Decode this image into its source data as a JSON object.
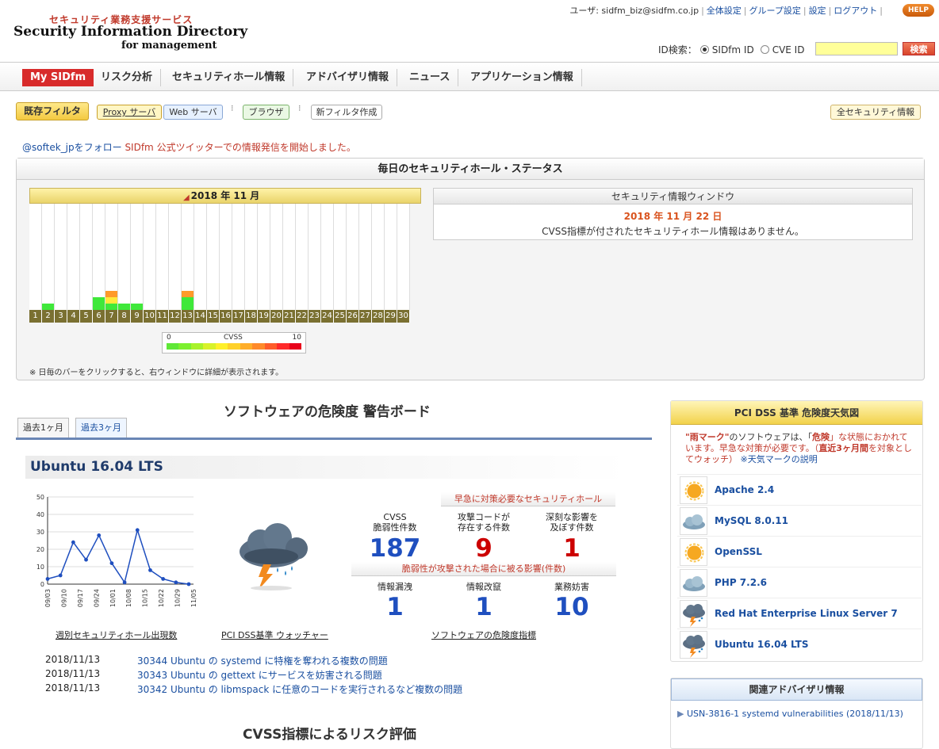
{
  "header": {
    "logo_sub": "セキュリティ業務支援サービス",
    "logo_main": "Security Information Directory",
    "logo_main2": "for management",
    "user_label": "ユーザ: sidfm_biz@sidfm.co.jp",
    "links": [
      "全体設定",
      "グループ設定",
      "設定",
      "ログアウト"
    ],
    "help": "HELP",
    "id_search_label": "ID検索：",
    "radio_sidfm": "SIDfm ID",
    "radio_cve": "CVE ID",
    "search_button": "検索"
  },
  "nav": [
    "My SIDfm",
    "リスク分析",
    "セキュリティホール情報",
    "アドバイザリ情報",
    "ニュース",
    "アプリケーション情報"
  ],
  "filters": {
    "existing": "既存フィルタ",
    "proxy": "Proxy サーバ",
    "web": "Web サーバ",
    "browser": "ブラウザ",
    "new_filter": "新フィルタ作成",
    "all_security": "全セキュリティ情報"
  },
  "notice": {
    "part1": "@softek_jpをフォロー",
    "part2": "SIDfm 公式ツイッターでの情報発信を開始しました。"
  },
  "status": {
    "title": "毎日のセキュリティホール・ステータス",
    "calendar_title": "2018 年 11 月",
    "legend_min": "0",
    "legend_label": "CVSS",
    "legend_max": "10",
    "note": "※ 日毎のバーをクリックすると、右ウィンドウに詳細が表示されます。",
    "window_title": "セキュリティ情報ウィンドウ",
    "window_date": "2018 年 11 月 22 日",
    "window_msg": "CVSS指標が付されたセキュリティホール情報はありません。",
    "days": [
      "1",
      "2",
      "3",
      "4",
      "5",
      "6",
      "7",
      "8",
      "9",
      "10",
      "11",
      "12",
      "13",
      "14",
      "15",
      "16",
      "17",
      "18",
      "19",
      "20",
      "21",
      "22",
      "23",
      "24",
      "25",
      "26",
      "27",
      "28",
      "29",
      "30"
    ]
  },
  "board": {
    "title": "ソフトウェアの危険度 警告ボード",
    "tab_1m": "過去1ヶ月",
    "tab_3m": "過去3ヶ月",
    "software": "Ubuntu 16.04 LTS",
    "caption_chart": "週別セキュリティホール出現数",
    "caption_weather": "PCI DSS基準 ウォッチャー",
    "caption_metrics": "ソフトウェアの危険度指標",
    "urgent_head": "早急に対策必要なセキュリティホール",
    "impact_head": "脆弱性が攻撃された場合に被る影響(件数)",
    "metrics": {
      "cvss_label": "CVSS\n脆弱性件数",
      "cvss_value": "187",
      "exploit_label": "攻撃コードが\n存在する件数",
      "exploit_value": "9",
      "severe_label": "深刻な影響を\n及ぼす件数",
      "severe_value": "1",
      "leak_label": "情報漏洩",
      "leak_value": "1",
      "tamper_label": "情報改竄",
      "tamper_value": "1",
      "dos_label": "業務妨害",
      "dos_value": "10"
    },
    "news": [
      {
        "date": "2018/11/13",
        "text": "30344 Ubuntu の systemd に特権を奪われる複数の問題"
      },
      {
        "date": "2018/11/13",
        "text": "30343 Ubuntu の gettext にサービスを妨害される問題"
      },
      {
        "date": "2018/11/13",
        "text": "30342 Ubuntu の libmspack に任意のコードを実行されるなど複数の問題"
      }
    ],
    "cvss_title": "CVSS指標によるリスク評価"
  },
  "chart_data": {
    "type": "line",
    "title": "",
    "x": [
      "09/03",
      "09/10",
      "09/17",
      "09/24",
      "10/01",
      "10/08",
      "10/15",
      "10/22",
      "10/29",
      "11/05"
    ],
    "series_x_labels": [
      "09/03",
      "09/10",
      "09/17",
      "09/24",
      "10/01",
      "10/08",
      "10/15",
      "10/22",
      "10/29",
      "11/05"
    ],
    "values": [
      3,
      5,
      24,
      14,
      28,
      12,
      1,
      31,
      8,
      3,
      1,
      0
    ],
    "ylim": [
      0,
      50
    ],
    "yticks": [
      "50",
      "40",
      "30",
      "20",
      "10",
      "0"
    ],
    "color": "#1f4fbf"
  },
  "pci": {
    "title": "PCI DSS 基準 危険度天気図",
    "desc_a": "\"雨マーク\"",
    "desc_b": "のソフトウェアは、「",
    "desc_c": "危険",
    "desc_d": "」な状態におかれています。早急な対策が必要です。（",
    "desc_e": "直近3ヶ月間",
    "desc_f": "を対象としてウォッチ）",
    "desc_link": "※天気マークの説明",
    "items": [
      {
        "name": "Apache 2.4",
        "icon": "sunny-icon"
      },
      {
        "name": "MySQL 8.0.11",
        "icon": "cloudy-icon"
      },
      {
        "name": "OpenSSL",
        "icon": "sunny-icon"
      },
      {
        "name": "PHP 7.2.6",
        "icon": "cloudy-icon"
      },
      {
        "name": "Red Hat Enterprise Linux Server 7",
        "icon": "storm-icon"
      },
      {
        "name": "Ubuntu 16.04 LTS",
        "icon": "storm-icon"
      }
    ]
  },
  "advisory": {
    "title": "関連アドバイザリ情報",
    "item": "USN-3816-1 systemd vulnerabilities (2018/11/13)"
  },
  "colors": {
    "accent_red": "#d82b2b",
    "link_blue": "#1a4fa0",
    "metric_blue": "#1f4fbf",
    "metric_red": "#cc0000"
  }
}
